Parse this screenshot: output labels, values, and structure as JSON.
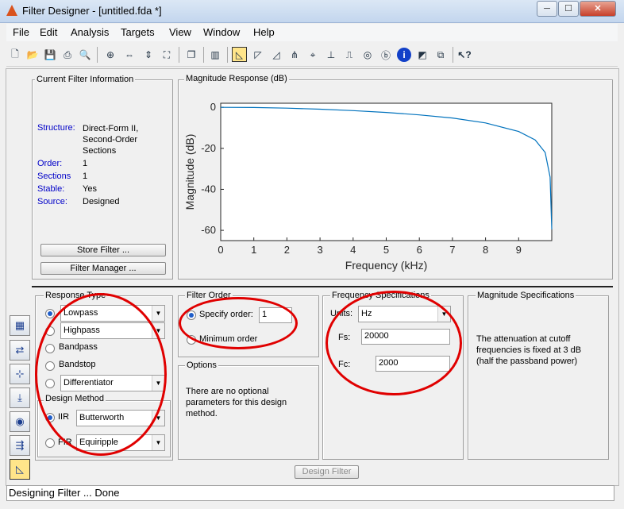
{
  "window": {
    "title": "Filter Designer - [untitled.fda *]",
    "min": "─",
    "max": "☐",
    "close": "✕"
  },
  "menu": [
    "File",
    "Edit",
    "Analysis",
    "Targets",
    "View",
    "Window",
    "Help"
  ],
  "toolbar": {
    "icons": [
      "new-icon",
      "open-icon",
      "save-icon",
      "print-icon",
      "print-preview-icon",
      "zoom-in-icon",
      "zoom-x-icon",
      "zoom-full-icon",
      "new-window-icon",
      "full-view-analysis-icon",
      "magnitude-response-icon",
      "phase-response-icon",
      "mag-phase-icon",
      "group-delay-icon",
      "phase-delay-icon",
      "impulse-response-icon",
      "step-response-icon",
      "pole-zero-icon",
      "filter-coefficients-icon",
      "filter-info-icon",
      "magnitude-specs-icon",
      "round-off-noise-icon",
      "whats-this-icon"
    ]
  },
  "current_filter": {
    "title": "Current Filter Information",
    "structure_label": "Structure:",
    "structure_value": "Direct-Form II, Second-Order Sections",
    "order_label": "Order:",
    "order_value": "1",
    "sections_label": "Sections",
    "sections_value": "1",
    "stable_label": "Stable:",
    "stable_value": "Yes",
    "source_label": "Source:",
    "source_value": "Designed",
    "store_button": "Store Filter ...",
    "manager_button": "Filter Manager ..."
  },
  "magnitude_panel": {
    "title": "Magnitude Response (dB)"
  },
  "chart_data": {
    "type": "line",
    "xlabel": "Frequency (kHz)",
    "ylabel": "Magnitude (dB)",
    "xlim": [
      0,
      10
    ],
    "ylim": [
      -65,
      2
    ],
    "xticks": [
      "0",
      "1",
      "2",
      "3",
      "4",
      "5",
      "6",
      "7",
      "8",
      "9"
    ],
    "yticks": [
      "0",
      "-20",
      "-40",
      "-60"
    ],
    "color": "#0072bd",
    "x": [
      0,
      1,
      2,
      3,
      4,
      5,
      6,
      7,
      8,
      9,
      9.5,
      9.8,
      9.95,
      10
    ],
    "y": [
      0,
      -0.1,
      -0.4,
      -0.9,
      -1.6,
      -2.5,
      -3.7,
      -5.2,
      -7.6,
      -11.8,
      -15.9,
      -22.0,
      -34.0,
      -59.5
    ]
  },
  "response_type": {
    "title": "Response Type",
    "options": [
      "Lowpass",
      "Highpass",
      "Bandpass",
      "Bandstop",
      "Differentiator"
    ]
  },
  "design_method": {
    "title": "Design Method",
    "iir_label": "IIR",
    "iir_value": "Butterworth",
    "fir_label": "FIR",
    "fir_value": "Equiripple"
  },
  "filter_order": {
    "title": "Filter Order",
    "specify_label": "Specify order:",
    "specify_value": "1",
    "minimum_label": "Minimum order"
  },
  "options": {
    "title": "Options",
    "text": "There are no optional parameters for this design method."
  },
  "frequency_specs": {
    "title": "Frequency Specifications",
    "units_label": "Units:",
    "units_value": "Hz",
    "fs_label": "Fs:",
    "fs_value": "20000",
    "fc_label": "Fc:",
    "fc_value": "2000"
  },
  "magnitude_specs": {
    "title": "Magnitude Specifications",
    "text": "The attenuation at cutoff frequencies is fixed at 3 dB (half the passband power)"
  },
  "design_button": "Design Filter",
  "status": "Designing Filter ... Done"
}
